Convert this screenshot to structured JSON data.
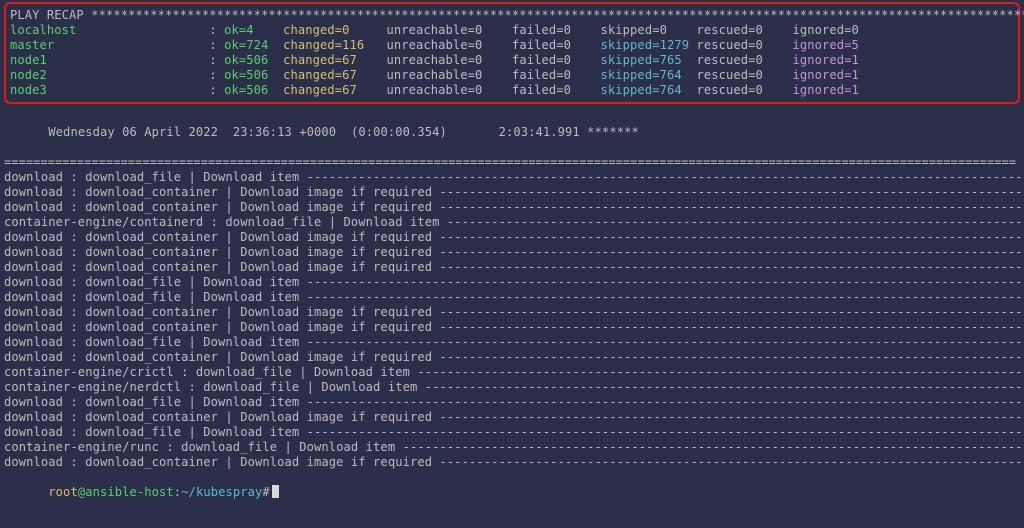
{
  "recap": {
    "title": "PLAY RECAP",
    "stars_count": 135,
    "hosts": [
      {
        "name": "localhost",
        "ok": 4,
        "changed": 0,
        "unreachable": 0,
        "failed": 0,
        "skipped": 0,
        "rescued": 0,
        "ignored": 0,
        "highlight": false
      },
      {
        "name": "master",
        "ok": 724,
        "changed": 116,
        "unreachable": 0,
        "failed": 0,
        "skipped": 1279,
        "rescued": 0,
        "ignored": 5,
        "highlight": true
      },
      {
        "name": "node1",
        "ok": 506,
        "changed": 67,
        "unreachable": 0,
        "failed": 0,
        "skipped": 765,
        "rescued": 0,
        "ignored": 1,
        "highlight": true
      },
      {
        "name": "node2",
        "ok": 506,
        "changed": 67,
        "unreachable": 0,
        "failed": 0,
        "skipped": 764,
        "rescued": 0,
        "ignored": 1,
        "highlight": true
      },
      {
        "name": "node3",
        "ok": 506,
        "changed": 67,
        "unreachable": 0,
        "failed": 0,
        "skipped": 764,
        "rescued": 0,
        "ignored": 1,
        "highlight": true
      }
    ]
  },
  "timing_line": {
    "date": "Wednesday 06 April 2022",
    "time": "23:36:13 +0000",
    "elapsed": "(0:00:00.354)",
    "total": "2:03:41.991",
    "trailing_stars": "*******"
  },
  "divider_equals_count": 139,
  "log_lines": [
    "download : download_file | Download item",
    "download : download_container | Download image if required",
    "download : download_container | Download image if required",
    "container-engine/containerd : download_file | Download item",
    "download : download_container | Download image if required",
    "download : download_container | Download image if required",
    "download : download_container | Download image if required",
    "download : download_file | Download item",
    "download : download_file | Download item",
    "download : download_container | Download image if required",
    "download : download_container | Download image if required",
    "download : download_file | Download item",
    "download : download_container | Download image if required",
    "container-engine/crictl : download_file | Download item",
    "container-engine/nerdctl : download_file | Download item",
    "download : download_file | Download item",
    "download : download_container | Download image if required",
    "download : download_file | Download item",
    "container-engine/runc : download_file | Download item",
    "download : download_container | Download image if required"
  ],
  "log_dash_width": 139,
  "prompt": {
    "user": "root",
    "host": "ansible-host",
    "path": "~/kubespray",
    "symbol": "#"
  }
}
